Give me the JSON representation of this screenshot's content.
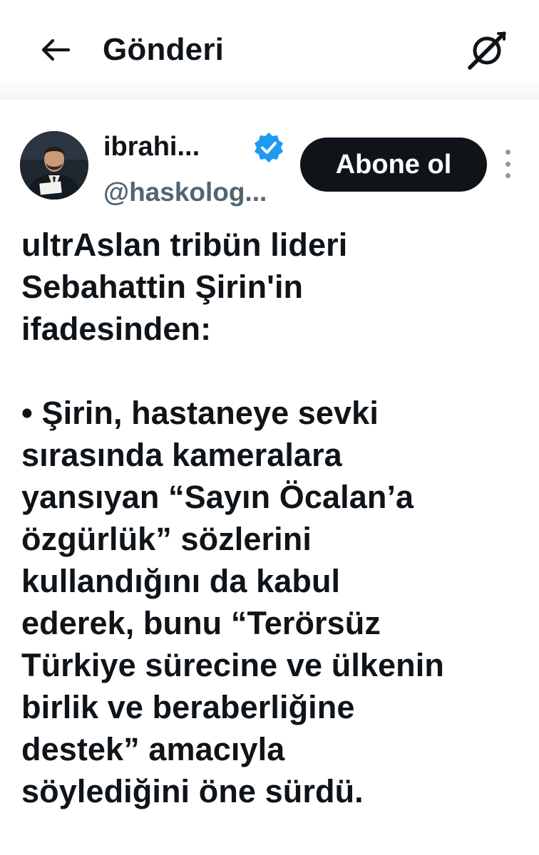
{
  "header": {
    "title": "Gönderi",
    "back_icon": "arrow-left-icon",
    "grok_icon": "grok-icon"
  },
  "post": {
    "author": {
      "display_name": "ibrahi...",
      "handle": "@haskolog...",
      "verified": true,
      "verified_color": "#1d9bf0"
    },
    "subscribe_label": "Abone ol",
    "more_icon": "more-vertical-icon",
    "text": {
      "line1": "ultrAslan tribün lideri",
      "line2": "Sebahattin Şirin'in",
      "line3": "ifadesinden:",
      "line4": "• Şirin, hastaneye sevki",
      "line5": "sırasında kameralara",
      "line6": "yansıyan “Sayın Öcalan’a",
      "line7": "özgürlük” sözlerini",
      "line8": "kullandığını da kabul",
      "line9": "ederek, bunu “Terörsüz",
      "line10": "Türkiye sürecine ve ülkenin",
      "line11": "birlik ve beraberliğine",
      "line12": "destek” amacıyla",
      "line13": "söylediğini öne sürdü."
    }
  },
  "colors": {
    "text": "#0f1419",
    "secondary_text": "#536471",
    "button_bg": "#0f1419",
    "button_text": "#ffffff",
    "verified": "#1d9bf0"
  }
}
